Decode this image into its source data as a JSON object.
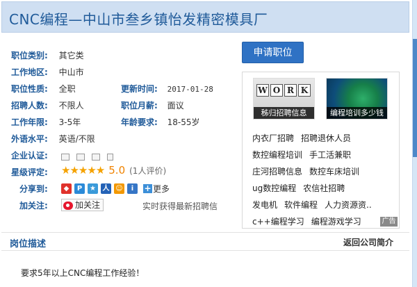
{
  "page_title": "CNC编程—中山市叁乡镇怡发精密模具厂",
  "apply_button": "申请职位",
  "info": {
    "category_label": "职位类别:",
    "category_value": "其它类",
    "region_label": "工作地区:",
    "region_value": "中山市",
    "nature_label": "职位性质:",
    "nature_value": "全职",
    "updated_label": "更新时间:",
    "updated_value": "2017-01-28",
    "recruit_label": "招聘人数:",
    "recruit_value": "不限人",
    "salary_label": "职位月薪:",
    "salary_value": "面议",
    "years_label": "工作年限:",
    "years_value": "3-5年",
    "age_label": "年龄要求:",
    "age_value": "18-55岁",
    "lang_label": "外语水平:",
    "lang_value": "英语/不限",
    "cert_label": "企业认证:",
    "rating_label": "星级评定:",
    "rating_score": "5.0",
    "rating_stars": 5,
    "rating_count": "(1人评价)",
    "share_label": "分享到:",
    "share_more": "更多",
    "follow_label": "加关注:",
    "follow_button": "加关注",
    "follow_note": "实时获得最新招聘信"
  },
  "ad": {
    "img1_caption": "秭归招聘信息",
    "img1_letters": [
      "W",
      "O",
      "R",
      "K"
    ],
    "img2_caption": "编程培训多少钱",
    "links": [
      [
        "内衣厂招聘",
        "招聘退休人员"
      ],
      [
        "数控编程培训",
        "手工活兼职"
      ],
      [
        "庄河招聘信息",
        "数控车床培训"
      ],
      [
        "ug数控编程",
        "农信社招聘"
      ],
      [
        "发电机",
        "软件编程",
        "人力资源资.."
      ],
      [
        "c++编程学习",
        "编程游戏学习"
      ]
    ],
    "tag": "广告"
  },
  "section": {
    "title": "岗位描述",
    "link": "返回公司简介",
    "description": "要求5年以上CNC编程工作经验！"
  },
  "colors": {
    "title_bg": "#cfdff2",
    "label_blue": "#1f5a99",
    "button_blue": "#2f72c4",
    "star": "#f5a200",
    "score": "#f08300"
  }
}
